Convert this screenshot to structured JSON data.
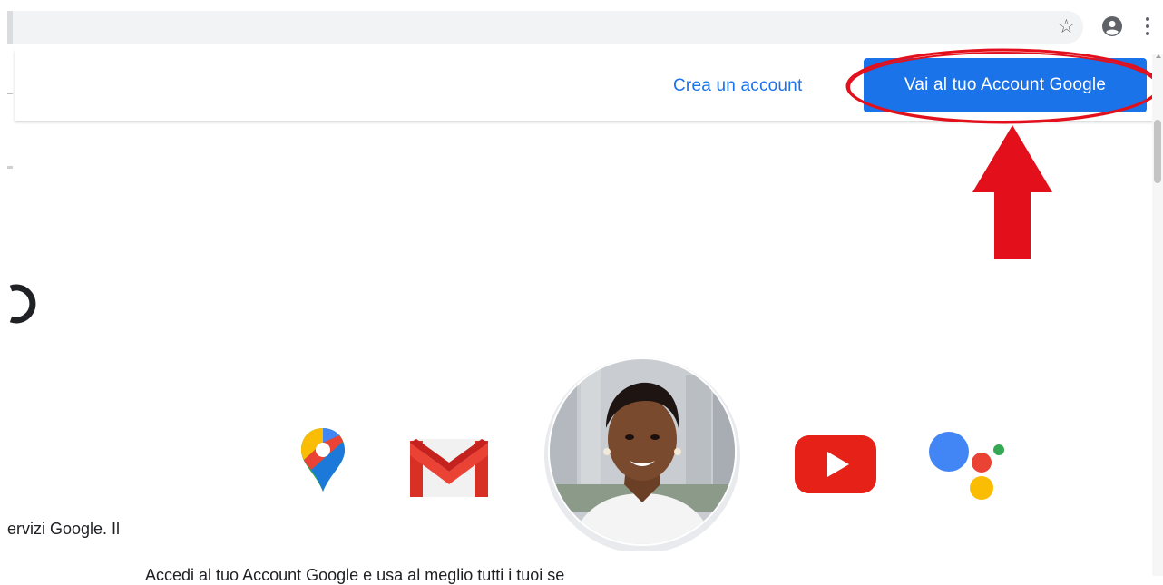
{
  "header": {
    "create_account_label": "Crea un account",
    "go_to_account_label": "Vai al tuo Account Google"
  },
  "body_text": {
    "services_fragment": "ervizi Google. Il",
    "bottom_line": "Accedi al tuo Account Google e usa al meglio tutti i tuoi se"
  },
  "icons": {
    "browser": [
      "bookmark-star-icon",
      "profile-icon",
      "more-menu-icon"
    ],
    "products": [
      "google-maps-icon",
      "gmail-icon",
      "profile-photo",
      "youtube-icon",
      "google-assistant-icon"
    ]
  },
  "colors": {
    "primary_blue": "#1a73e8",
    "annotation_red": "#e3101c"
  }
}
